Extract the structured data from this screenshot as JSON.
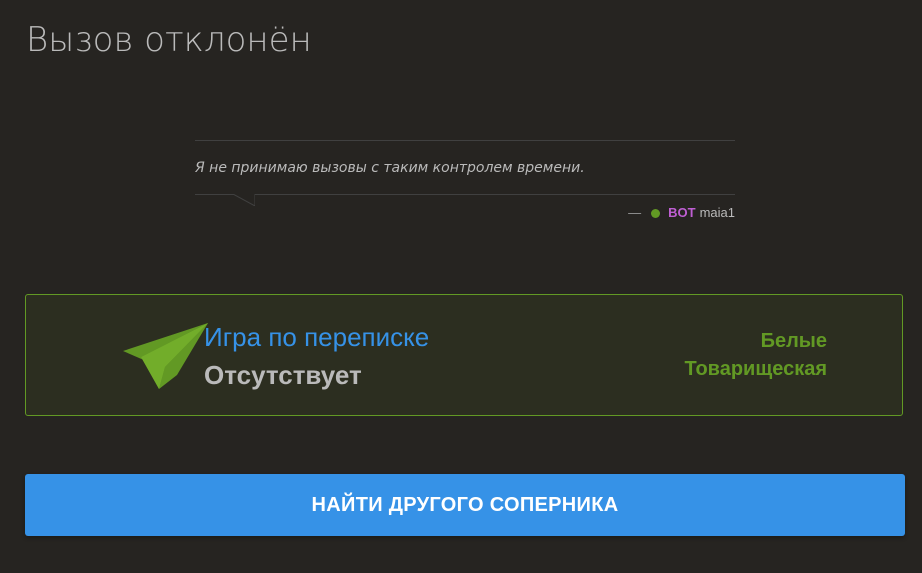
{
  "page": {
    "title": "Вызов отклонён"
  },
  "decline": {
    "message": "Я не принимаю вызовы с таким контролем времени.",
    "signature": {
      "dash": "—",
      "bot_badge": "BOT",
      "username": "maia1"
    }
  },
  "game": {
    "icon": "paper-plane-icon",
    "mode": "Игра по переписке",
    "time_control": "Отсутствует",
    "side": "Белые",
    "rating_type": "Товарищеская"
  },
  "actions": {
    "find_opponent_label": "НАЙТИ ДРУГОГО СОПЕРНИКА"
  },
  "colors": {
    "background": "#262421",
    "accent_blue": "#3692e7",
    "accent_green": "#629924",
    "bot_purple": "#bf5fd3"
  }
}
